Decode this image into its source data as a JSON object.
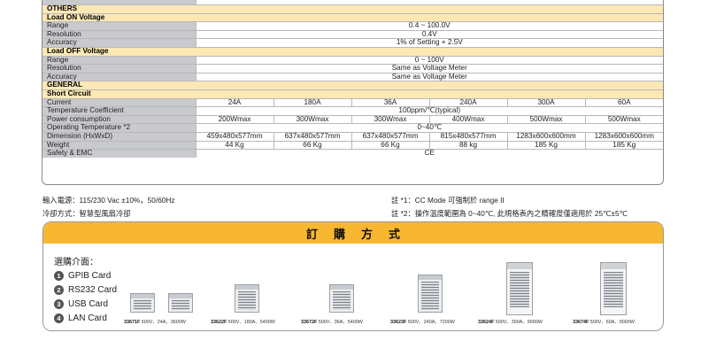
{
  "spec": {
    "others": {
      "section": "OTHERS",
      "load_on": {
        "title": "Load ON Voltage",
        "range_label": "Range",
        "range": "0.4 ~ 100.0V",
        "resolution_label": "Resolution",
        "resolution": "0.4V",
        "accuracy_label": "Accuracy",
        "accuracy": "1% of Setting + 2.5V"
      },
      "load_off": {
        "title": "Load OFF Voltage",
        "range_label": "Range",
        "range": "0 ~ 100V",
        "resolution_label": "Resolution",
        "resolution": "Same as Voltage Meter",
        "accuracy_label": "Accuracy",
        "accuracy": "Same as Voltage Meter"
      }
    },
    "general": {
      "section": "GENERAL",
      "short_circuit": "Short Circuit",
      "current_label": "Current",
      "current": [
        "24A",
        "180A",
        "36A",
        "240A",
        "300A",
        "60A"
      ],
      "temp_coeff_label": "Temperature Coefficient",
      "temp_coeff": "100ppm/℃(typical)",
      "power_label": "Power consumption",
      "power": [
        "200Wmax",
        "300Wmax",
        "300Wmax",
        "400Wmax",
        "500Wmax",
        "500Wmax"
      ],
      "op_temp_label": "Operating Temperature *2",
      "op_temp": "0~40℃",
      "dimension_label": "Dimension (HxWxD)",
      "dimension": [
        "459x480x577mm",
        "637x480x577mm",
        "637x480x577mm",
        "815x480x577mm",
        "1283x600x600mm",
        "1283x600x600mm"
      ],
      "weight_label": "Weight",
      "weight": [
        "44 Kg",
        "66 Kg",
        "66 Kg",
        "88 kg",
        "185 Kg",
        "185 Kg"
      ],
      "safety_label": "Safety & EMC",
      "safety": "CE"
    }
  },
  "notes": {
    "power_input": "輸入電源：115/230 Vac ±10%，50/60Hz",
    "cooling": "冷卻方式：智慧型風扇冷卻",
    "note1": "註 *1：CC Mode 可強制於 range II",
    "note2": "註 *2：操作溫度範圍為 0~40℃, 此規格表內之精確度僅適用於 25℃±5℃"
  },
  "ordering": {
    "title": "訂購方式",
    "interface_title": "選購介面：",
    "interfaces": [
      {
        "num": "1",
        "label": "GPIB Card"
      },
      {
        "num": "2",
        "label": "RS232 Card"
      },
      {
        "num": "3",
        "label": "USB Card"
      },
      {
        "num": "4",
        "label": "LAN Card"
      }
    ],
    "models": [
      {
        "name": "33671F",
        "spec": " 500V、24A、3600W"
      },
      {
        "name": "33622F",
        "spec": " 500V、180A、5400W"
      },
      {
        "name": "33672F",
        "spec": " 500V、36A、5400W"
      },
      {
        "name": "33623F",
        "spec": " 500V、240A、7200W"
      },
      {
        "name": "33624F",
        "spec": " 500V、300A、9000W"
      },
      {
        "name": "33674F",
        "spec": " 500V、60A、9000W"
      }
    ]
  }
}
